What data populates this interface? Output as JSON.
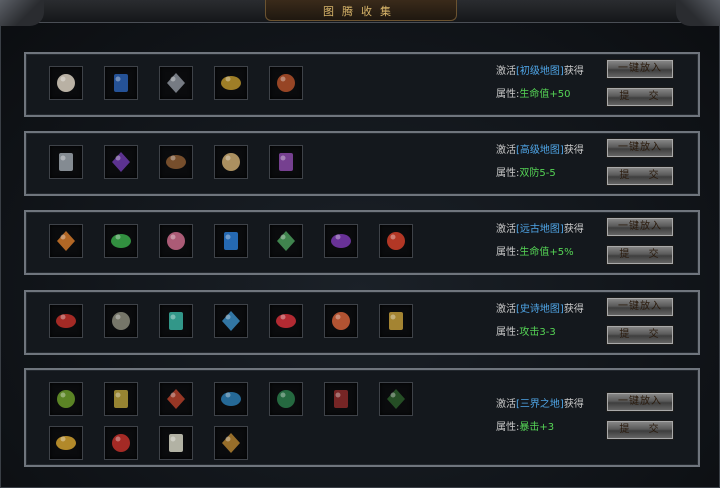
{
  "window": {
    "title": "图腾收集"
  },
  "labels": {
    "activate_prefix": "激活",
    "activate_suffix": "获得",
    "attr_prefix": "属性:"
  },
  "panels": [
    {
      "map": "[初级地图]",
      "attr": "生命值+50",
      "one_key_label": "一键放入",
      "submit_label": "提 交",
      "items": [
        {
          "icon": "bone-icon",
          "color": "#d8cfc0"
        },
        {
          "icon": "blue-amulet-icon",
          "color": "#2a5fb0"
        },
        {
          "icon": "claw-icon",
          "color": "#8a8f99"
        },
        {
          "icon": "golden-beast-icon",
          "color": "#b8932d"
        },
        {
          "icon": "red-shell-icon",
          "color": "#b0502a"
        }
      ]
    },
    {
      "map": "[高级地图]",
      "attr": "双防5-5",
      "one_key_label": "一键放入",
      "submit_label": "提 交",
      "items": [
        {
          "icon": "ring-icon",
          "color": "#9aa2aa"
        },
        {
          "icon": "purple-book-icon",
          "color": "#6b3aa8"
        },
        {
          "icon": "stick-icon",
          "color": "#8a5a32"
        },
        {
          "icon": "horn-icon",
          "color": "#c8a870"
        },
        {
          "icon": "purple-claw-icon",
          "color": "#8a4aa8"
        }
      ]
    },
    {
      "map": "[远古地图]",
      "attr": "生命值+5%",
      "one_key_label": "一键放入",
      "submit_label": "提 交",
      "items": [
        {
          "icon": "orange-scroll-icon",
          "color": "#d0782a"
        },
        {
          "icon": "green-pendant-icon",
          "color": "#3aa84a"
        },
        {
          "icon": "pink-worm-icon",
          "color": "#c86a8a"
        },
        {
          "icon": "blue-orb-icon",
          "color": "#2a7ad0"
        },
        {
          "icon": "green-egg-icon",
          "color": "#4a9a5a"
        },
        {
          "icon": "purple-banner-icon",
          "color": "#7a3ab0"
        },
        {
          "icon": "red-star-icon",
          "color": "#d0402a"
        }
      ]
    },
    {
      "map": "[史诗地图]",
      "attr": "攻击3-3",
      "one_key_label": "一键放入",
      "submit_label": "提 交",
      "items": [
        {
          "icon": "red-rune-icon",
          "color": "#c0302a"
        },
        {
          "icon": "skull-emblem-icon",
          "color": "#8a8a7a"
        },
        {
          "icon": "golden-globe-icon",
          "color": "#3ab0a0"
        },
        {
          "icon": "blue-coin-icon",
          "color": "#3a8ac0"
        },
        {
          "icon": "red-gem-icon",
          "color": "#d0303a"
        },
        {
          "icon": "orange-coin-icon",
          "color": "#d0603a"
        },
        {
          "icon": "lion-coin-icon",
          "color": "#c09a3a"
        }
      ]
    },
    {
      "map": "[三界之地]",
      "attr": "暴击+3",
      "one_key_label": "一键放入",
      "submit_label": "提 交",
      "items": [
        {
          "icon": "green-rune-icon",
          "color": "#6a9a2a"
        },
        {
          "icon": "golden-rune-icon",
          "color": "#b09a3a"
        },
        {
          "icon": "red-bottle-icon",
          "color": "#b0402a"
        },
        {
          "icon": "blue-bottle-icon",
          "color": "#2a7ab0"
        },
        {
          "icon": "green-tome-icon",
          "color": "#2a7a4a"
        },
        {
          "icon": "red-tome-icon",
          "color": "#8a2a2a"
        },
        {
          "icon": "dark-green-tome-icon",
          "color": "#2a5a2a"
        },
        {
          "icon": "golden-knot-icon",
          "color": "#d0a030"
        },
        {
          "icon": "red-book-icon",
          "color": "#c0302a"
        },
        {
          "icon": "white-cloth-icon",
          "color": "#d0d0c0"
        },
        {
          "icon": "twin-dragon-icon",
          "color": "#b08030"
        }
      ]
    }
  ]
}
